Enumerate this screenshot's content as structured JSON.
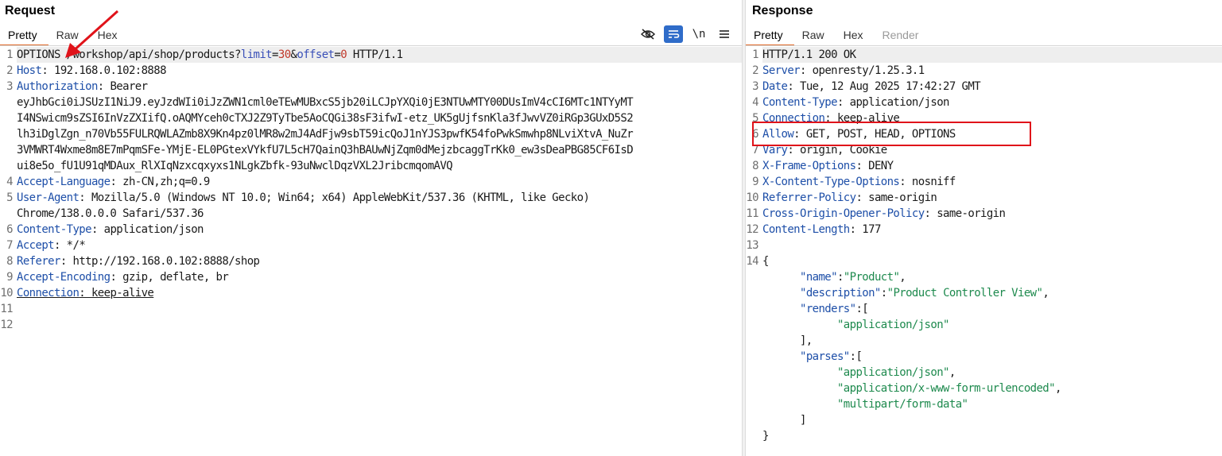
{
  "request": {
    "title": "Request",
    "tabs": [
      "Pretty",
      "Raw",
      "Hex"
    ],
    "toolbar": {
      "wrap": "\\n"
    },
    "lines": [
      {
        "n": "1",
        "method": "OPTIONS",
        "path": " /workshop/api/shop/products?",
        "p1": "limit",
        "eq1": "=",
        "v1": "30",
        "amp": "&",
        "p2": "offset",
        "eq2": "=",
        "v2": "0",
        "proto": " HTTP/1.1"
      },
      {
        "n": "2",
        "key": "Host",
        "val": "192.168.0.102:8888"
      },
      {
        "n": "3",
        "key": "Authorization",
        "val": "Bearer",
        "cont": [
          "eyJhbGci0iJSUzI1NiJ9.eyJzdWIi0iJzZWN1cml0eTEwMUBxcS5jb20iLCJpYXQi0jE3NTUwMTY00DUsImV4cCI6MTc1NTYyMT",
          "I4NSwicm9sZSI6InVzZXIifQ.oAQMYceh0cTXJ2Z9TyTbe5AoCQGi38sF3ifwI-etz_UK5gUjfsnKla3fJwvVZ0iRGp3GUxD5S2",
          "lh3iDglZgn_n70Vb55FULRQWLAZmb8X9Kn4pz0lMR8w2mJ4AdFjw9sbT59icQoJ1nYJS3pwfK54foPwkSmwhp8NLviXtvA_NuZr",
          "3VMWRT4Wxme8m8E7mPqmSFe-YMjE-EL0PGtexVYkfU7L5cH7QainQ3hBAUwNjZqm0dMejzbcaggTrKk0_ew3sDeaPBG85CF6IsD",
          "ui8e5o_fU1U91qMDAux_RlXIqNzxcqxyxs1NLgkZbfk-93uNwclDqzVXL2JribcmqomAVQ"
        ]
      },
      {
        "n": "4",
        "key": "Accept-Language",
        "val": "zh-CN,zh;q=0.9"
      },
      {
        "n": "5",
        "key": "User-Agent",
        "val": "Mozilla/5.0 (Windows NT 10.0; Win64; x64) AppleWebKit/537.36 (KHTML, like Gecko)",
        "cont": [
          "Chrome/138.0.0.0 Safari/537.36"
        ]
      },
      {
        "n": "6",
        "key": "Content-Type",
        "val": "application/json"
      },
      {
        "n": "7",
        "key": "Accept",
        "val": "*/*"
      },
      {
        "n": "8",
        "key": "Referer",
        "val": "http://192.168.0.102:8888/shop"
      },
      {
        "n": "9",
        "key": "Accept-Encoding",
        "val": "gzip, deflate, br"
      },
      {
        "n": "10",
        "key": "Connection",
        "val": "keep-alive"
      },
      {
        "n": "11"
      },
      {
        "n": "12"
      }
    ]
  },
  "response": {
    "title": "Response",
    "tabs": [
      "Pretty",
      "Raw",
      "Hex",
      "Render"
    ],
    "status_line": {
      "n": "1",
      "text": "HTTP/1.1 200 OK"
    },
    "headers": [
      {
        "n": "2",
        "key": "Server",
        "val": "openresty/1.25.3.1"
      },
      {
        "n": "3",
        "key": "Date",
        "val": "Tue, 12 Aug 2025 17:42:27 GMT"
      },
      {
        "n": "4",
        "key": "Content-Type",
        "val": "application/json"
      },
      {
        "n": "5",
        "key": "Connection",
        "val": "keep-alive"
      },
      {
        "n": "6",
        "key": "Allow",
        "val": "GET, POST, HEAD, OPTIONS"
      },
      {
        "n": "7",
        "key": "Vary",
        "val": "origin, Cookie"
      },
      {
        "n": "8",
        "key": "X-Frame-Options",
        "val": "DENY"
      },
      {
        "n": "9",
        "key": "X-Content-Type-Options",
        "val": "nosniff"
      },
      {
        "n": "10",
        "key": "Referrer-Policy",
        "val": "same-origin"
      },
      {
        "n": "11",
        "key": "Cross-Origin-Opener-Policy",
        "val": "same-origin"
      },
      {
        "n": "12",
        "key": "Content-Length",
        "val": "177"
      }
    ],
    "body_line_numbers": [
      "13",
      "14"
    ],
    "body": {
      "name_key": "\"name\"",
      "name_val": "\"Product\"",
      "description_key": "\"description\"",
      "description_val": "\"Product Controller View\"",
      "renders_key": "\"renders\"",
      "renders": [
        "\"application/json\""
      ],
      "parses_key": "\"parses\"",
      "parses": [
        "\"application/json\"",
        "\"application/x-www-form-urlencoded\"",
        "\"multipart/form-data\""
      ]
    }
  },
  "colors": {
    "accent": "#e06c2c",
    "key": "#1e4fa8",
    "value_number": "#c0392b",
    "json_string": "#1e8a4e",
    "annotation_red": "#e0131a",
    "active_tool": "#2f6cc9"
  },
  "icons": [
    "hide-icon",
    "wrap-lines-icon",
    "newline-icon",
    "menu-icon",
    "annotation-arrow"
  ]
}
